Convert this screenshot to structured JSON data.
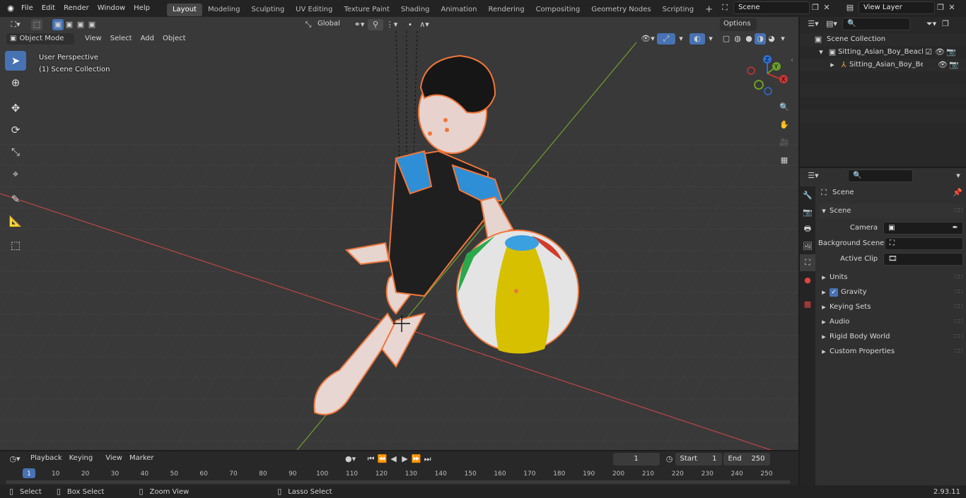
{
  "topbar": {
    "menus": [
      "File",
      "Edit",
      "Render",
      "Window",
      "Help"
    ],
    "workspaces": [
      "Layout",
      "Modeling",
      "Sculpting",
      "UV Editing",
      "Texture Paint",
      "Shading",
      "Animation",
      "Rendering",
      "Compositing",
      "Geometry Nodes",
      "Scripting"
    ],
    "active_workspace": "Layout",
    "add_workspace": "+",
    "scene_name": "Scene",
    "view_layer": "View Layer"
  },
  "viewport": {
    "header": {
      "mode": "Object Mode",
      "menus": [
        "View",
        "Select",
        "Add",
        "Object"
      ],
      "orientation": "Global",
      "options": "Options"
    },
    "overlay_title": "User Perspective",
    "overlay_collection": "(1) Scene Collection",
    "gizmo": {
      "x": "X",
      "y": "Y",
      "z": "Z"
    },
    "colors": {
      "background": "#393939",
      "grid": "#454545",
      "x_axis": "#b54444",
      "y_axis": "#6c9a2c",
      "selection": "#f0763a",
      "active_tool": "#4772b3"
    }
  },
  "outliner": {
    "root": "Scene Collection",
    "items": [
      {
        "label": "Sitting_Asian_Boy_Beach_Sty",
        "level": 1
      },
      {
        "label": "Sitting_Asian_Boy_Beach",
        "level": 2
      }
    ]
  },
  "properties": {
    "context": "Scene",
    "section": "Scene",
    "fields": [
      {
        "label": "Camera",
        "value": ""
      },
      {
        "label": "Background Scene",
        "value": ""
      },
      {
        "label": "Active Clip",
        "value": ""
      }
    ],
    "panels": [
      "Units",
      "Gravity",
      "Keying Sets",
      "Audio",
      "Rigid Body World",
      "Custom Properties"
    ],
    "gravity_checked": true
  },
  "timeline": {
    "menus": [
      "Playback",
      "Keying",
      "View",
      "Marker"
    ],
    "current_frame": "1",
    "start_label": "Start",
    "start": "1",
    "end_label": "End",
    "end": "250",
    "ticks": [
      "1",
      "10",
      "20",
      "30",
      "40",
      "50",
      "60",
      "70",
      "80",
      "90",
      "100",
      "110",
      "120",
      "130",
      "140",
      "150",
      "160",
      "170",
      "180",
      "190",
      "200",
      "210",
      "220",
      "230",
      "240",
      "250"
    ]
  },
  "statusbar": {
    "select": "Select",
    "box_select": "Box Select",
    "zoom_view": "Zoom View",
    "lasso_select": "Lasso Select",
    "version": "2.93.11"
  }
}
